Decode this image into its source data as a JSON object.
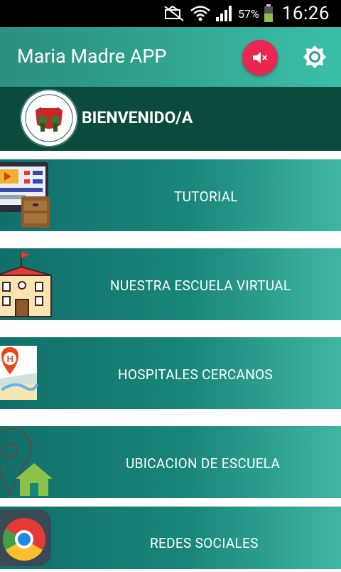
{
  "status_bar": {
    "battery": "57%",
    "time": "16:26"
  },
  "app_bar": {
    "title": "Maria Madre APP"
  },
  "welcome": {
    "text": "BIENVENIDO/A"
  },
  "menu": [
    {
      "label": "TUTORIAL",
      "icon": "video-tutorial-icon"
    },
    {
      "label": "NUESTRA ESCUELA VIRTUAL",
      "icon": "school-building-icon"
    },
    {
      "label": "HOSPITALES CERCANOS",
      "icon": "hospital-map-pin-icon"
    },
    {
      "label": "UBICACION DE ESCUELA",
      "icon": "location-home-icon"
    },
    {
      "label": "REDES SOCIALES",
      "icon": "chrome-icon"
    }
  ],
  "colors": {
    "app_bar": "#2fa08b",
    "welcome_bar": "#0b4a3e",
    "mute_button": "#e8264f",
    "menu_gradient_start": "#11706a",
    "menu_gradient_end": "#3fb6a2"
  }
}
